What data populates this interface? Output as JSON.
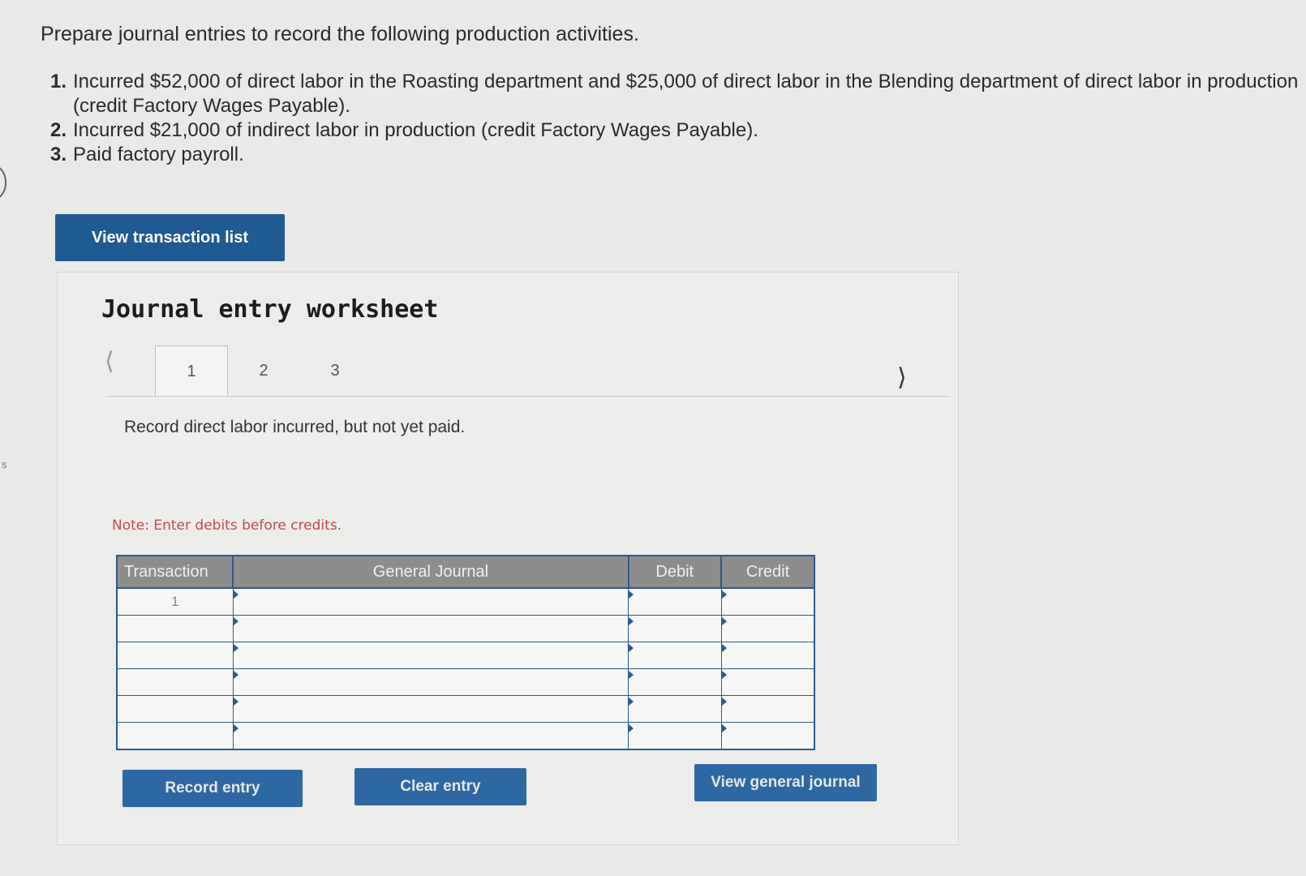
{
  "prompt": "Prepare journal entries to record the following production activities.",
  "tasks": [
    {
      "num": "1.",
      "text": "Incurred $52,000 of direct labor in the Roasting department and $25,000 of direct labor in the Blending department of direct labor in production (credit Factory Wages Payable)."
    },
    {
      "num": "2.",
      "text": "Incurred $21,000 of indirect labor in production (credit Factory Wages Payable)."
    },
    {
      "num": "3.",
      "text": "Paid factory payroll."
    }
  ],
  "view_transaction_list": "View transaction list",
  "worksheet": {
    "title": "Journal entry worksheet",
    "prev_icon": "chevron-left-icon",
    "next_icon": "chevron-right-icon",
    "tabs": [
      "1",
      "2",
      "3"
    ],
    "active_tab": "1",
    "instruction": "Record direct labor incurred, but not yet paid.",
    "note": "Note: Enter debits before credits.",
    "table": {
      "headers": [
        "Transaction",
        "General Journal",
        "Debit",
        "Credit"
      ],
      "rows": [
        {
          "transaction": "1",
          "account": "",
          "debit": "",
          "credit": ""
        },
        {
          "transaction": "",
          "account": "",
          "debit": "",
          "credit": ""
        },
        {
          "transaction": "",
          "account": "",
          "debit": "",
          "credit": ""
        },
        {
          "transaction": "",
          "account": "",
          "debit": "",
          "credit": ""
        },
        {
          "transaction": "",
          "account": "",
          "debit": "",
          "credit": ""
        },
        {
          "transaction": "",
          "account": "",
          "debit": "",
          "credit": ""
        }
      ]
    },
    "buttons": {
      "record": "Record entry",
      "clear": "Clear entry",
      "view_general_journal": "View general journal"
    }
  },
  "side_mark": "s"
}
